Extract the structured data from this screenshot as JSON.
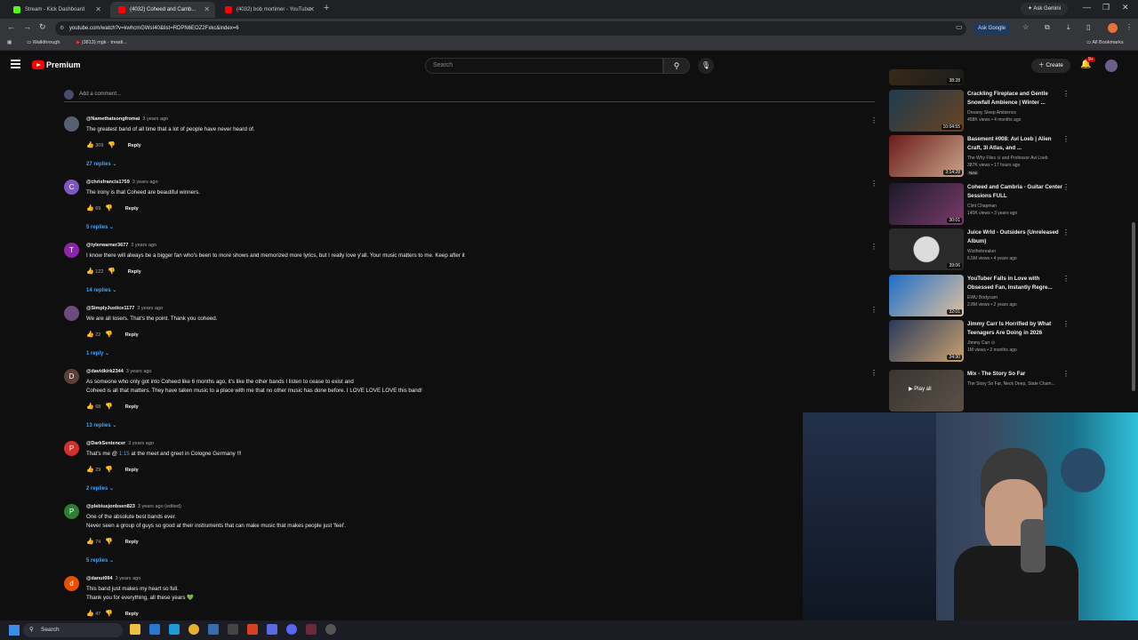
{
  "browser": {
    "tabs": [
      {
        "label": "Stream - Kick Dashboard",
        "color": "#53fc18"
      },
      {
        "label": "(4032) Coheed and Camb...",
        "color": "#ff0000"
      },
      {
        "label": "(4032) bob mortimer - YouTube",
        "color": "#ff0000"
      }
    ],
    "ask_gemini": "Ask Gemini",
    "url": "youtube.com/watch?v=kwhcmGWsI40&list=RDPN6EOZ2Fxkc&index=6",
    "ask_google": "Ask Google",
    "bookmarks": [
      "Walkthrough",
      "(3813) mgk - treadi...",
      "All Bookmarks"
    ]
  },
  "header": {
    "brand": "Premium",
    "search_placeholder": "Search",
    "create_label": "Create",
    "notif_badge": "9+"
  },
  "add_comment": "Add a comment...",
  "comments": [
    {
      "avatar": "",
      "avatar_color": "#556070",
      "handle": "@Namethatsongfromai",
      "age": "3 years ago",
      "lines": [
        "The greatest band of all time that a lot of people have never heard of."
      ],
      "likes": "309",
      "replies": "27 replies"
    },
    {
      "avatar": "C",
      "avatar_color": "#7e57c2",
      "handle": "@chrisfrancis1759",
      "age": "3 years ago",
      "lines": [
        "The irony is that Coheed are beautiful winners."
      ],
      "likes": "69",
      "replies": "5 replies"
    },
    {
      "avatar": "T",
      "avatar_color": "#8e24aa",
      "handle": "@tylerwarner3677",
      "age": "3 years ago",
      "lines": [
        "I know there will always be a bigger fan who's been to more shows and memorized more lyrics, but I really love y'all. Your music matters to me. Keep after it"
      ],
      "likes": "122",
      "replies": "14 replies"
    },
    {
      "avatar": "",
      "avatar_color": "#6d4c7d",
      "handle": "@SimplyJustice1177",
      "age": "3 years ago",
      "lines": [
        "We are all losers. That's the point. Thank you coheed."
      ],
      "likes": "22",
      "replies": "1 reply"
    },
    {
      "avatar": "D",
      "avatar_color": "#5d4037",
      "handle": "@davidkirk2344",
      "age": "3 years ago",
      "lines": [
        "As someone who only got into Coheed like 6 months ago, it's like the other bands I listen to cease to exist and",
        "Coheed is all that matters. They have taken music to a place with me that no other music has done before. I LOVE LOVE LOVE this band!"
      ],
      "likes": "68",
      "replies": "13 replies"
    },
    {
      "avatar": "P",
      "avatar_color": "#d32f2f",
      "handle": "@DarkSentencer",
      "age": "3 years ago",
      "text_before": "That's me @ ",
      "timestamp": "1:15",
      "text_after": " at the meet and greet in Cologne Germany !!!",
      "likes": "29",
      "replies": "2 replies"
    },
    {
      "avatar": "P",
      "avatar_color": "#2e7d32",
      "handle": "@plebiusjonbsen823",
      "age": "3 years ago (edited)",
      "lines": [
        "One of the absolute best bands ever.",
        "Never seen a group of guys so good at their instruments that can make music that makes people just 'feel'."
      ],
      "likes": "74",
      "replies": "5 replies"
    },
    {
      "avatar": "d",
      "avatar_color": "#e65100",
      "handle": "@danut094",
      "age": "3 years ago",
      "lines": [
        "This band just makes my heart so full.",
        "Thank you for everything, all these years 💚"
      ],
      "likes": "47",
      "replies": ""
    }
  ],
  "actions": {
    "reply": "Reply"
  },
  "sidebar": {
    "items": [
      {
        "title": "",
        "meta1": "",
        "meta2": "",
        "duration": "38:28",
        "colors": [
          "#3a2a1a",
          "#1a1a1a"
        ]
      },
      {
        "title": "Crackling Fireplace and Gentle Snowfall Ambience | Winter ...",
        "meta1": "Dreamy Sleep Ambience",
        "meta2": "458K views • 4 months ago",
        "duration": "10:04:55",
        "colors": [
          "#1e3a4f",
          "#6a4320"
        ]
      },
      {
        "title": "Basement #008: Avi Loeb | Alien Craft, 3I Atlas, and ...",
        "meta1": "The Why Files ⊙ and Professor Avi Loeb",
        "meta2": "387K views • 17 hours ago",
        "duration": "3:14:28",
        "colors": [
          "#6b1b1b",
          "#c8a58a"
        ],
        "badge": "New"
      },
      {
        "title": "Coheed and Cambria - Guitar Center Sessions FULL",
        "meta1": "Clint Chapman",
        "meta2": "140K views • 3 years ago",
        "duration": "30:01",
        "colors": [
          "#1a1a2a",
          "#7a3a6a"
        ]
      },
      {
        "title": "Juice Wrld - Outsiders (Unreleased Album)",
        "meta1": "Wizthebreaker",
        "meta2": "6.5M views • 4 years ago",
        "duration": "39:06",
        "colors": [
          "#2a2a2a",
          "#dcdcdc"
        ]
      },
      {
        "title": "YouTuber Falls in Love with Obsessed Fan, Instantly Regre...",
        "meta1": "EWU Bodycam",
        "meta2": "2.8M views • 2 years ago",
        "duration": "32:01",
        "colors": [
          "#1e6fc8",
          "#e0c0a0"
        ]
      },
      {
        "title": "Jimmy Carr Is Horrified by What Teenagers Are Doing in 2026",
        "meta1": "Jimmy Carr ⊙",
        "meta2": "1M views • 2 months ago",
        "duration": "24:30",
        "colors": [
          "#2a3a5a",
          "#c8a070"
        ]
      },
      {
        "title": "Mix - The Story So Far",
        "meta1": "The Story So Far, Neck Deep, State Cham...",
        "meta2": "",
        "duration": "",
        "play_all": "Play all",
        "colors": [
          "#3a3530",
          "#5a5048"
        ]
      }
    ]
  },
  "taskbar": {
    "search_label": "Search"
  }
}
